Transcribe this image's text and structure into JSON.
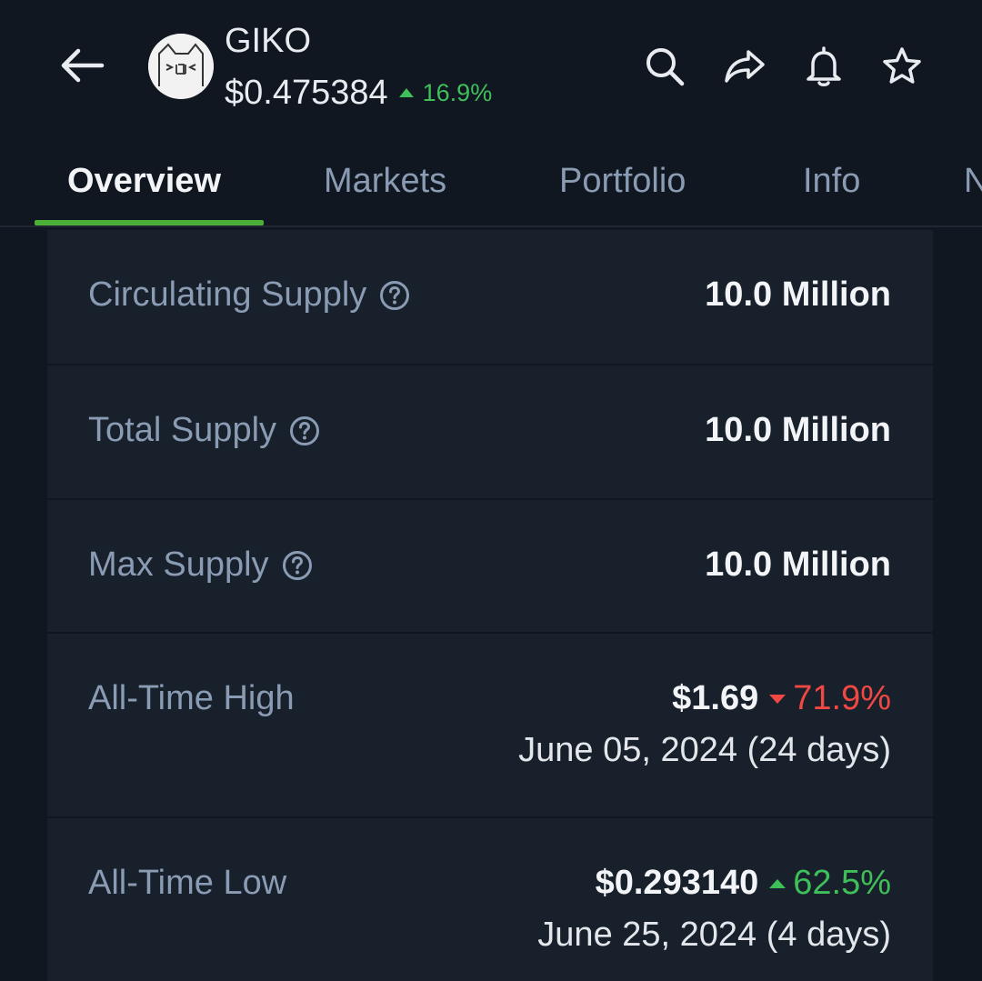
{
  "header": {
    "coin_name": "GIKO",
    "price": "$0.475384",
    "change": "16.9%",
    "avatar_icon": "cat-face-icon"
  },
  "tabs": [
    {
      "label": "Overview",
      "active": true
    },
    {
      "label": "Markets",
      "active": false
    },
    {
      "label": "Portfolio",
      "active": false
    },
    {
      "label": "Info",
      "active": false
    },
    {
      "label": "N",
      "active": false
    }
  ],
  "stats": {
    "circulating_supply": {
      "label": "Circulating Supply",
      "value": "10.0 Million"
    },
    "total_supply": {
      "label": "Total Supply",
      "value": "10.0 Million"
    },
    "max_supply": {
      "label": "Max Supply",
      "value": "10.0 Million"
    },
    "all_time_high": {
      "label": "All-Time High",
      "price": "$1.69",
      "change": "71.9%",
      "date": "June 05, 2024 (24 days)"
    },
    "all_time_low": {
      "label": "All-Time Low",
      "price": "$0.293140",
      "change": "62.5%",
      "date": "June 25, 2024 (4 days)"
    }
  },
  "colors": {
    "background": "#111720",
    "card": "#18202b",
    "positive": "#3fbf5a",
    "negative": "#f04842",
    "tab_accent": "#4caf38"
  }
}
